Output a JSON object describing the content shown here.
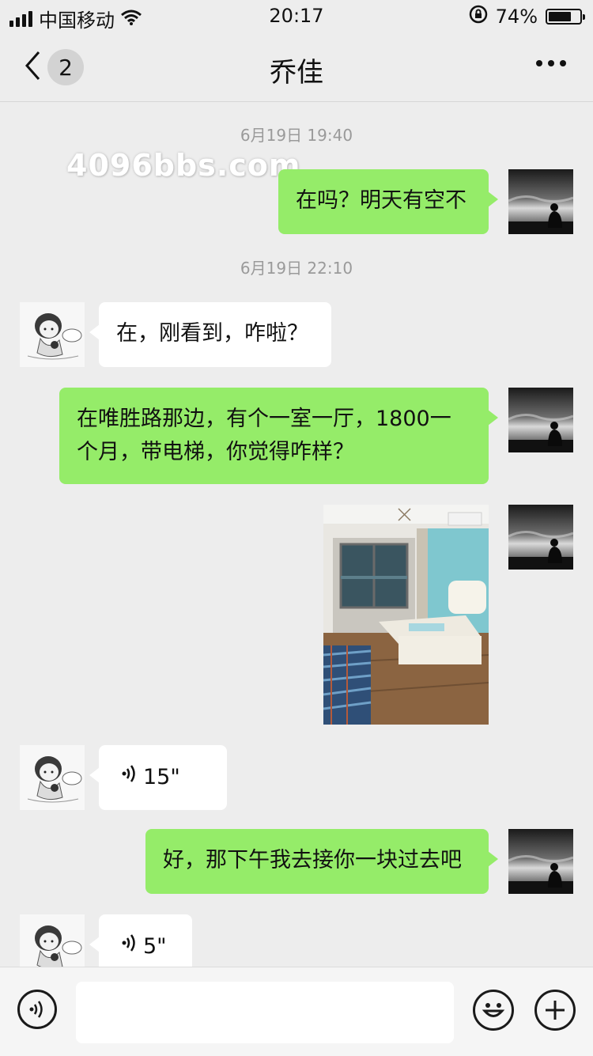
{
  "status_bar": {
    "carrier": "中国移动",
    "time": "20:17",
    "battery_percent": "74%",
    "battery_level": 0.74,
    "icons": [
      "signal-icon",
      "wifi-icon",
      "rotation-lock-icon",
      "battery-icon"
    ]
  },
  "nav": {
    "title": "乔佳",
    "unread_count": "2",
    "icons": [
      "back-chevron-icon",
      "more-dots-icon"
    ]
  },
  "watermark": "4096bbs.com",
  "messages": [
    {
      "type": "timestamp",
      "text": "6月19日 19:40"
    },
    {
      "type": "text",
      "side": "right",
      "text": "在吗？明天有空不"
    },
    {
      "type": "timestamp",
      "text": "6月19日 22:10"
    },
    {
      "type": "text",
      "side": "left",
      "text": "在，刚看到，咋啦？"
    },
    {
      "type": "text",
      "side": "right",
      "text_line1": "在唯胜路那边，有个一室一厅，1800一",
      "text_line2": "个月，带电梯，你觉得咋样？"
    },
    {
      "type": "image",
      "side": "right",
      "description_icon": "bedroom-photo"
    },
    {
      "type": "voice",
      "side": "left",
      "duration": "15\""
    },
    {
      "type": "text",
      "side": "right",
      "text": "好，那下午我去接你一块过去吧"
    },
    {
      "type": "voice",
      "side": "left",
      "duration": "5\""
    }
  ],
  "input_bar": {
    "placeholder": "",
    "icons": [
      "voice-input-icon",
      "emoji-icon",
      "plus-icon"
    ]
  },
  "colors": {
    "background": "#ededed",
    "sent_bubble": "#95ec69",
    "received_bubble": "#ffffff",
    "timestamp_text": "#9a9a9a"
  }
}
